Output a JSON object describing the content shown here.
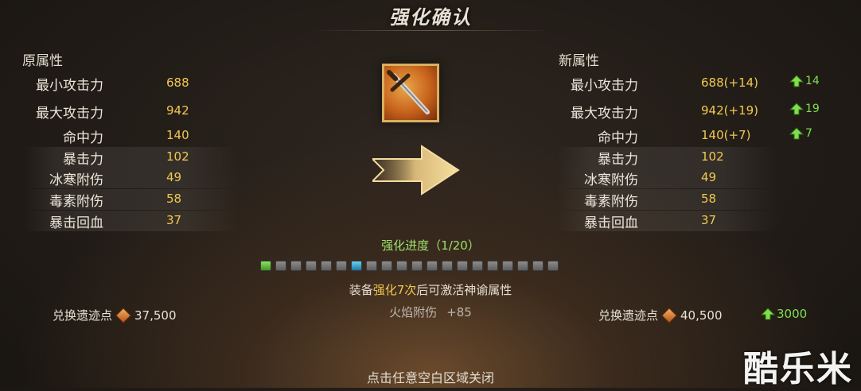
{
  "title": "强化确认",
  "left": {
    "heading": "原属性",
    "stats": [
      {
        "label": "最小攻击力",
        "value": "688"
      },
      {
        "label": "最大攻击力",
        "value": "942"
      },
      {
        "label": "命中力",
        "value": "140"
      },
      {
        "label": "暴击力",
        "value": "102"
      },
      {
        "label": "冰寒附伤",
        "value": "49"
      },
      {
        "label": "毒素附伤",
        "value": "58"
      },
      {
        "label": "暴击回血",
        "value": "37"
      }
    ],
    "relic_label": "兑换遗迹点",
    "relic_value": "37,500"
  },
  "right": {
    "heading": "新属性",
    "stats": [
      {
        "label": "最小攻击力",
        "value": "688(+14)",
        "increase": "14"
      },
      {
        "label": "最大攻击力",
        "value": "942(+19)",
        "increase": "19"
      },
      {
        "label": "命中力",
        "value": "140(+7)",
        "increase": "7"
      },
      {
        "label": "暴击力",
        "value": "102"
      },
      {
        "label": "冰寒附伤",
        "value": "49"
      },
      {
        "label": "毒素附伤",
        "value": "58"
      },
      {
        "label": "暴击回血",
        "value": "37"
      }
    ],
    "relic_label": "兑换遗迹点",
    "relic_value": "40,500",
    "relic_increase": "3000"
  },
  "item": {
    "icon": "sword-icon"
  },
  "progress": {
    "label": "强化进度（1/20）",
    "current": 1,
    "total": 20,
    "highlight_index": 7
  },
  "hint": {
    "prefix": "装备",
    "highlight": "强化7次",
    "suffix": "后可激活神谕属性"
  },
  "bonus": {
    "label": "火焰附伤",
    "value": "+85"
  },
  "close_tip": "点击任意空白区域关闭",
  "watermark": "酷乐米",
  "colors": {
    "value": "#f0c850",
    "increase": "#7ee04c",
    "progress_label": "#9ee06a"
  }
}
